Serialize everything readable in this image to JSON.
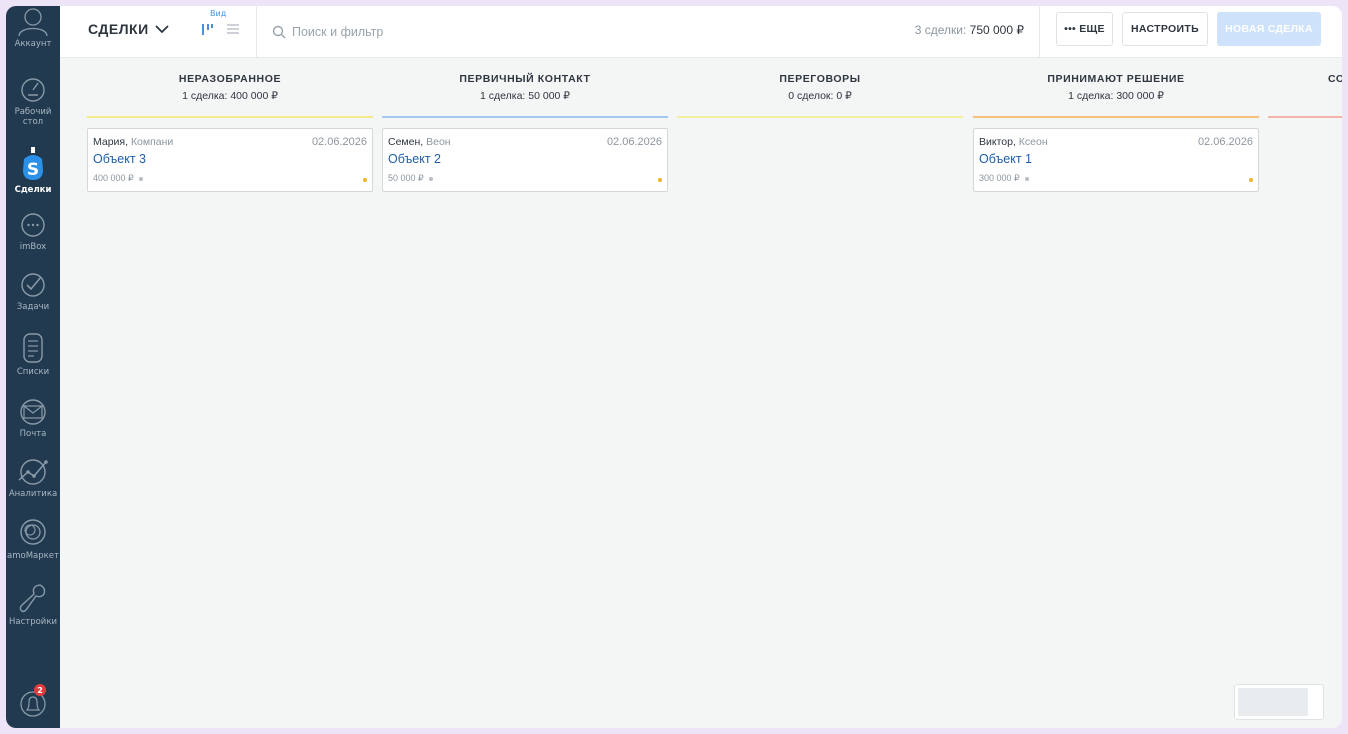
{
  "sidebar": {
    "items": [
      {
        "label": "Аккаунт",
        "icon": "account-icon"
      },
      {
        "label": "Рабочий стол",
        "icon": "dashboard-icon"
      },
      {
        "label": "Сделки",
        "icon": "deals-icon",
        "active": true
      },
      {
        "label": "imBox",
        "icon": "chat-icon"
      },
      {
        "label": "Задачи",
        "icon": "tasks-icon"
      },
      {
        "label": "Списки",
        "icon": "lists-icon"
      },
      {
        "label": "Почта",
        "icon": "mail-icon"
      },
      {
        "label": "Аналитика",
        "icon": "analytics-icon"
      },
      {
        "label": "amoМаркет",
        "icon": "market-icon"
      },
      {
        "label": "Настройки",
        "icon": "settings-icon"
      }
    ],
    "notifications_count": "2"
  },
  "header": {
    "title": "СДЕЛКИ",
    "view_label": "Вид",
    "search_placeholder": "Поиск и фильтр",
    "summary_prefix": "3 сделки:",
    "summary_value": "750 000 ₽",
    "more_label": "••• ЕЩЕ",
    "setup_label": "НАСТРОИТЬ",
    "new_deal_label": "НОВАЯ СДЕЛКА"
  },
  "columns": [
    {
      "title": "НЕРАЗОБРАННОЕ",
      "summary": "1 сделка: 400 000 ₽",
      "color": "#f2eb8a",
      "cards": [
        {
          "contact": "Мария,",
          "company": "Компани",
          "date": "02.06.2026",
          "title": "Объект 3",
          "price": "400 000 ₽",
          "status_color": "#f0b429"
        }
      ]
    },
    {
      "title": "ПЕРВИЧНЫЙ КОНТАКТ",
      "summary": "1 сделка: 50 000 ₽",
      "color": "#a6c8f0",
      "cards": [
        {
          "contact": "Семен,",
          "company": "Веон",
          "date": "02.06.2026",
          "title": "Объект 2",
          "price": "50 000 ₽",
          "status_color": "#f0b429"
        }
      ]
    },
    {
      "title": "ПЕРЕГОВОРЫ",
      "summary": "0 сделок: 0 ₽",
      "color": "#f4ef9c",
      "cards": []
    },
    {
      "title": "ПРИНИМАЮТ РЕШЕНИЕ",
      "summary": "1 сделка: 300 000 ₽",
      "color": "#f4c27a",
      "cards": [
        {
          "contact": "Виктор,",
          "company": "Ксеон",
          "date": "02.06.2026",
          "title": "Объект 1",
          "price": "300 000 ₽",
          "status_color": "#f0b429"
        }
      ]
    },
    {
      "title": "СО",
      "summary": "",
      "color": "#f4b4a8",
      "cards": []
    }
  ]
}
